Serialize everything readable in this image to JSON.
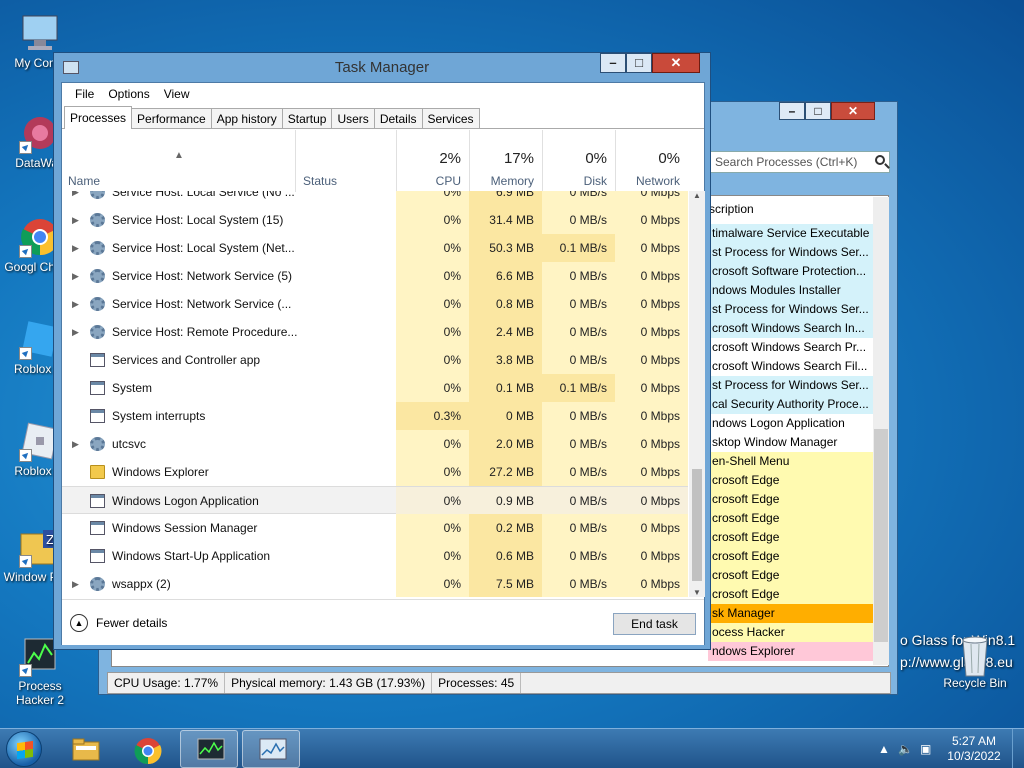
{
  "desktop": {
    "icons": [
      {
        "label": "My Comp",
        "icon": "computer-icon"
      },
      {
        "label": "DataWag",
        "icon": "datawag-icon"
      },
      {
        "label": "Googl Chrom",
        "icon": "chrome-icon"
      },
      {
        "label": "Roblox St",
        "icon": "roblox-studio-icon"
      },
      {
        "label": "Roblox Pl",
        "icon": "roblox-player-icon"
      },
      {
        "label": "Window Pack",
        "icon": "zip-folder-icon"
      },
      {
        "label": "Process Hacker 2",
        "icon": "process-hacker-icon"
      }
    ],
    "recycle_bin": "Recycle Bin",
    "glass_line1": "o Glass for Win8.1",
    "glass_line2": "p://www.glass8.eu"
  },
  "process_hacker": {
    "search_placeholder": "Search Processes (Ctrl+K)",
    "column_header": "scription",
    "rows": [
      {
        "text": "timalware Service Executable",
        "color": "#d4f2fa"
      },
      {
        "text": "st Process for Windows Ser...",
        "color": "#d4f2fa"
      },
      {
        "text": "crosoft Software Protection...",
        "color": "#d4f2fa"
      },
      {
        "text": "ndows Modules Installer",
        "color": "#d4f2fa"
      },
      {
        "text": "st Process for Windows Ser...",
        "color": "#d4f2fa"
      },
      {
        "text": "crosoft Windows Search In...",
        "color": "#d4f2fa"
      },
      {
        "text": "crosoft Windows Search Pr...",
        "color": "#ffffff"
      },
      {
        "text": "crosoft Windows Search Fil...",
        "color": "#ffffff"
      },
      {
        "text": "st Process for Windows Ser...",
        "color": "#d4f2fa"
      },
      {
        "text": "cal Security Authority Proce...",
        "color": "#d4f2fa"
      },
      {
        "text": "ndows Logon Application",
        "color": "#ffffff"
      },
      {
        "text": "sktop Window Manager",
        "color": "#ffffff"
      },
      {
        "text": "en-Shell Menu",
        "color": "#fffab0"
      },
      {
        "text": "crosoft Edge",
        "color": "#fffab0"
      },
      {
        "text": "crosoft Edge",
        "color": "#fffab0"
      },
      {
        "text": "crosoft Edge",
        "color": "#fffab0"
      },
      {
        "text": "crosoft Edge",
        "color": "#fffab0"
      },
      {
        "text": "crosoft Edge",
        "color": "#fffab0"
      },
      {
        "text": "crosoft Edge",
        "color": "#fffab0"
      },
      {
        "text": "crosoft Edge",
        "color": "#fffab0"
      },
      {
        "text": "sk Manager",
        "color": "#ffae00"
      },
      {
        "text": "ocess Hacker",
        "color": "#fffab0"
      },
      {
        "text": "ndows Explorer",
        "color": "#ffc8d8"
      }
    ],
    "status": {
      "cpu": "CPU Usage: 1.77%",
      "memory": "Physical memory: 1.43 GB (17.93%)",
      "processes": "Processes: 45"
    }
  },
  "task_manager": {
    "title": "Task Manager",
    "menu": [
      "File",
      "Options",
      "View"
    ],
    "tabs": [
      "Processes",
      "Performance",
      "App history",
      "Startup",
      "Users",
      "Details",
      "Services"
    ],
    "active_tab": "Processes",
    "columns": {
      "name": "Name",
      "status": "Status",
      "cpu": {
        "pct": "2%",
        "label": "CPU"
      },
      "memory": {
        "pct": "17%",
        "label": "Memory"
      },
      "disk": {
        "pct": "0%",
        "label": "Disk"
      },
      "network": {
        "pct": "0%",
        "label": "Network"
      }
    },
    "rows": [
      {
        "name": "Service Host: Local Service (No ...",
        "icon": "gear",
        "expandable": true,
        "cpu": "0%",
        "memory": "6.9 MB",
        "disk": "0 MB/s",
        "network": "0 Mbps"
      },
      {
        "name": "Service Host: Local System (15)",
        "icon": "gear",
        "expandable": true,
        "cpu": "0%",
        "memory": "31.4 MB",
        "disk": "0 MB/s",
        "network": "0 Mbps"
      },
      {
        "name": "Service Host: Local System (Net...",
        "icon": "gear",
        "expandable": true,
        "cpu": "0%",
        "memory": "50.3 MB",
        "disk": "0.1 MB/s",
        "network": "0 Mbps"
      },
      {
        "name": "Service Host: Network Service (5)",
        "icon": "gear",
        "expandable": true,
        "cpu": "0%",
        "memory": "6.6 MB",
        "disk": "0 MB/s",
        "network": "0 Mbps"
      },
      {
        "name": "Service Host: Network Service (...",
        "icon": "gear",
        "expandable": true,
        "cpu": "0%",
        "memory": "0.8 MB",
        "disk": "0 MB/s",
        "network": "0 Mbps"
      },
      {
        "name": "Service Host: Remote Procedure...",
        "icon": "gear",
        "expandable": true,
        "cpu": "0%",
        "memory": "2.4 MB",
        "disk": "0 MB/s",
        "network": "0 Mbps"
      },
      {
        "name": "Services and Controller app",
        "icon": "window",
        "expandable": false,
        "cpu": "0%",
        "memory": "3.8 MB",
        "disk": "0 MB/s",
        "network": "0 Mbps"
      },
      {
        "name": "System",
        "icon": "window",
        "expandable": false,
        "cpu": "0%",
        "memory": "0.1 MB",
        "disk": "0.1 MB/s",
        "network": "0 Mbps"
      },
      {
        "name": "System interrupts",
        "icon": "window",
        "expandable": false,
        "cpu": "0.3%",
        "memory": "0 MB",
        "disk": "0 MB/s",
        "network": "0 Mbps"
      },
      {
        "name": "utcsvc",
        "icon": "gear",
        "expandable": true,
        "cpu": "0%",
        "memory": "2.0 MB",
        "disk": "0 MB/s",
        "network": "0 Mbps"
      },
      {
        "name": "Windows Explorer",
        "icon": "folder",
        "expandable": false,
        "cpu": "0%",
        "memory": "27.2 MB",
        "disk": "0 MB/s",
        "network": "0 Mbps"
      },
      {
        "name": "Windows Logon Application",
        "icon": "window",
        "expandable": false,
        "cpu": "0%",
        "memory": "0.9 MB",
        "disk": "0 MB/s",
        "network": "0 Mbps",
        "selected": true
      },
      {
        "name": "Windows Session Manager",
        "icon": "window",
        "expandable": false,
        "cpu": "0%",
        "memory": "0.2 MB",
        "disk": "0 MB/s",
        "network": "0 Mbps"
      },
      {
        "name": "Windows Start-Up Application",
        "icon": "window",
        "expandable": false,
        "cpu": "0%",
        "memory": "0.6 MB",
        "disk": "0 MB/s",
        "network": "0 Mbps"
      },
      {
        "name": "wsappx (2)",
        "icon": "gear",
        "expandable": true,
        "cpu": "0%",
        "memory": "7.5 MB",
        "disk": "0 MB/s",
        "network": "0 Mbps"
      }
    ],
    "fewer_details": "Fewer details",
    "end_task": "End task"
  },
  "taskbar": {
    "time": "5:27 AM",
    "date": "10/3/2022"
  }
}
